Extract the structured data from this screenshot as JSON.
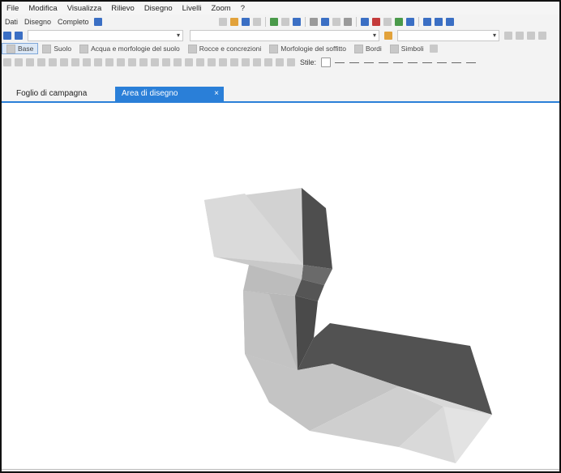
{
  "menu": {
    "items": [
      "File",
      "Modifica",
      "Visualizza",
      "Rilievo",
      "Disegno",
      "Livelli",
      "Zoom",
      "?"
    ]
  },
  "toolbar2": {
    "labels": [
      "Dati",
      "Disegno",
      "Completo"
    ]
  },
  "layers": {
    "items": [
      "Base",
      "Suolo",
      "Acqua e morfologie del suolo",
      "Rocce e concrezioni",
      "Morfologie del soffitto",
      "Bordi",
      "Simboli"
    ],
    "active": "Base"
  },
  "toolbar5": {
    "style_label": "Stile:"
  },
  "tabs": {
    "items": [
      "Foglio di campagna",
      "Area di disegno"
    ],
    "close_glyph": "×",
    "active": "Area di disegno"
  },
  "colors": {
    "accent": "#2a7fd8",
    "shape_light": "#d6d6d6",
    "shape_mid": "#bfbfbf",
    "shape_dark": "#5a5a5a"
  }
}
